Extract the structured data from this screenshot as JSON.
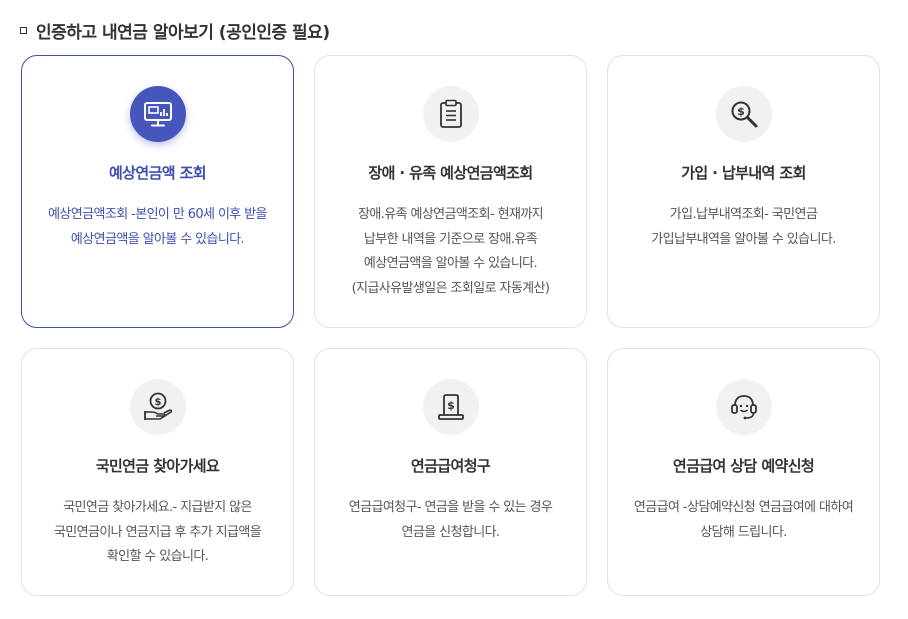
{
  "section": {
    "title": "인증하고 내연금 알아보기 (공인인증 필요)"
  },
  "colors": {
    "accent": "#4656bc",
    "active_border": "#3d4fb0",
    "card_border": "#e2e2e2",
    "icon_bg": "#f1f1f1",
    "text": "#333333",
    "muted_text": "#555555"
  },
  "cards": [
    {
      "icon": "monitor-chart-icon",
      "title": "예상연금액 조회",
      "desc": [
        "예상연금액조회 -본인이 만 60세 이후 받을",
        "예상연금액을 알아볼 수 있습니다."
      ],
      "active": true
    },
    {
      "icon": "clipboard-icon",
      "title": "장애 · 유족 예상연금액조회",
      "desc": [
        "장애.유족 예상연금액조회- 현재까지",
        "납부한 내역을 기준으로 장애.유족",
        "예상연금액을 알아볼 수 있습니다.",
        "(지급사유발생일은 조회일로 자동계산)"
      ],
      "active": false
    },
    {
      "icon": "magnifier-dollar-icon",
      "title": "가입 · 납부내역 조회",
      "desc": [
        "가입.납부내역조회- 국민연금",
        "가입납부내역을 알아볼 수 있습니다."
      ],
      "active": false
    },
    {
      "icon": "hand-coin-icon",
      "title": "국민연금 찾아가세요",
      "desc": [
        "국민연금 찾아가세요.- 지급받지 않은",
        "국민연금이나 연금지급 후 추가 지급액을",
        "확인할 수 있습니다."
      ],
      "active": false
    },
    {
      "icon": "document-dollar-icon",
      "title": "연금급여청구",
      "desc": [
        "연금급여청구- 연금을 받을 수 있는 경우",
        "연금을 신청합니다."
      ],
      "active": false
    },
    {
      "icon": "headset-icon",
      "title": "연금급여 상담 예약신청",
      "desc": [
        "연금급여 -상담예약신청 연금급여에 대하여",
        "상담해 드립니다."
      ],
      "active": false
    }
  ]
}
